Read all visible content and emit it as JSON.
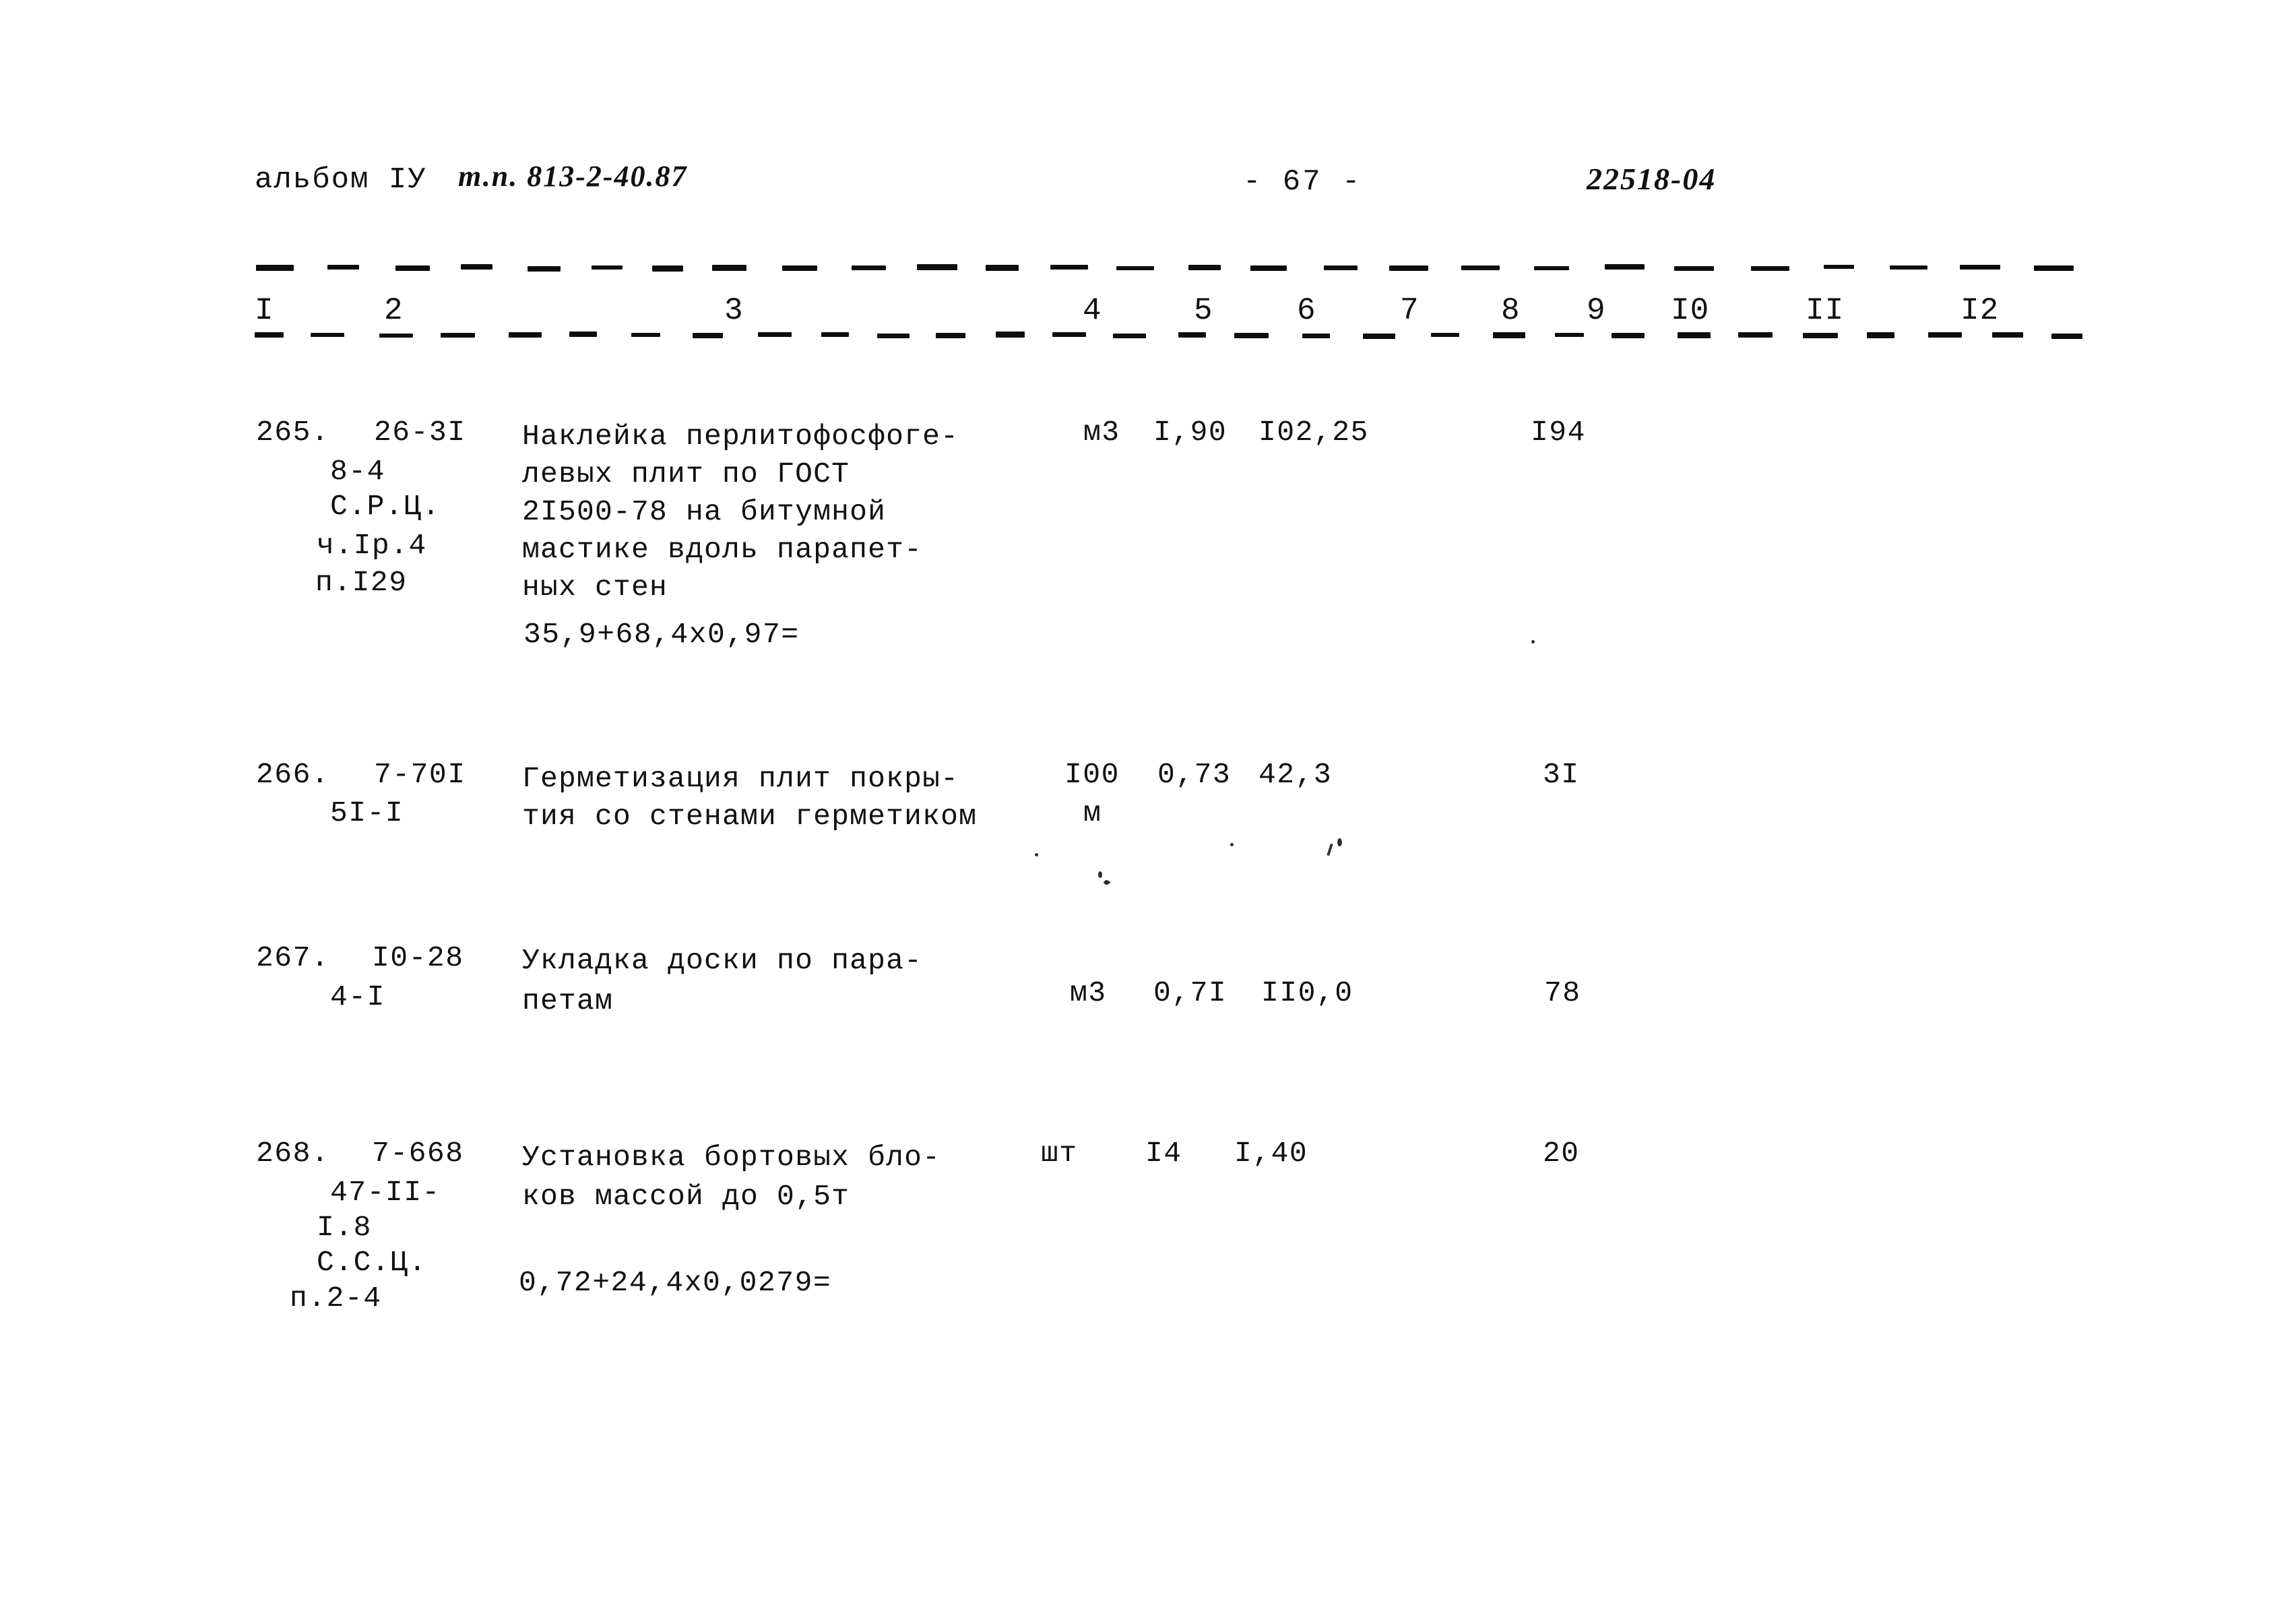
{
  "document": {
    "header": {
      "album_label": "альбом IУ",
      "project_code": "т.п. 813-2-40.87",
      "page_number": "- 67 -",
      "doc_number": "22518-04"
    },
    "column_numbers": [
      "I",
      "2",
      "3",
      "4",
      "5",
      "6",
      "7",
      "8",
      "9",
      "I0",
      "II",
      "I2"
    ],
    "rows": [
      {
        "number": "265.",
        "codes": [
          "26-3I",
          "8-4",
          "С.Р.Ц.",
          "ч.Iр.4",
          "п.I29"
        ],
        "description": [
          "Наклейка перлитофосфоге-",
          "левых плит по ГОСТ",
          "2I500-78 на битумной",
          "мастике вдоль парапет-",
          "ных стен"
        ],
        "unit": "м3",
        "col5": "I,90",
        "col6": "I02,25",
        "col9": "I94",
        "formula": "35,9+68,4х0,97="
      },
      {
        "number": "266.",
        "codes": [
          "7-70I",
          "5I-I"
        ],
        "description": [
          "Герметизация плит покры-",
          "тия со стенами герметиком"
        ],
        "unit": "I00",
        "unit2": "м",
        "col5": "0,73",
        "col6": "42,3",
        "col9": "3I",
        "formula": ""
      },
      {
        "number": "267.",
        "codes": [
          "I0-28",
          "4-I"
        ],
        "description": [
          "Укладка доски по пара-",
          "петам"
        ],
        "unit": "м3",
        "col5": "0,7I",
        "col6": "II0,0",
        "col9": "78",
        "formula": ""
      },
      {
        "number": "268.",
        "codes": [
          "7-668",
          "47-II-",
          "I.8",
          "С.С.Ц.",
          "п.2-4"
        ],
        "description": [
          "Установка бортовых бло-",
          "ков массой до 0,5т"
        ],
        "unit": "шт",
        "col5": "I4",
        "col6": "I,40",
        "col9": "20",
        "formula": "0,72+24,4х0,0279="
      }
    ]
  }
}
